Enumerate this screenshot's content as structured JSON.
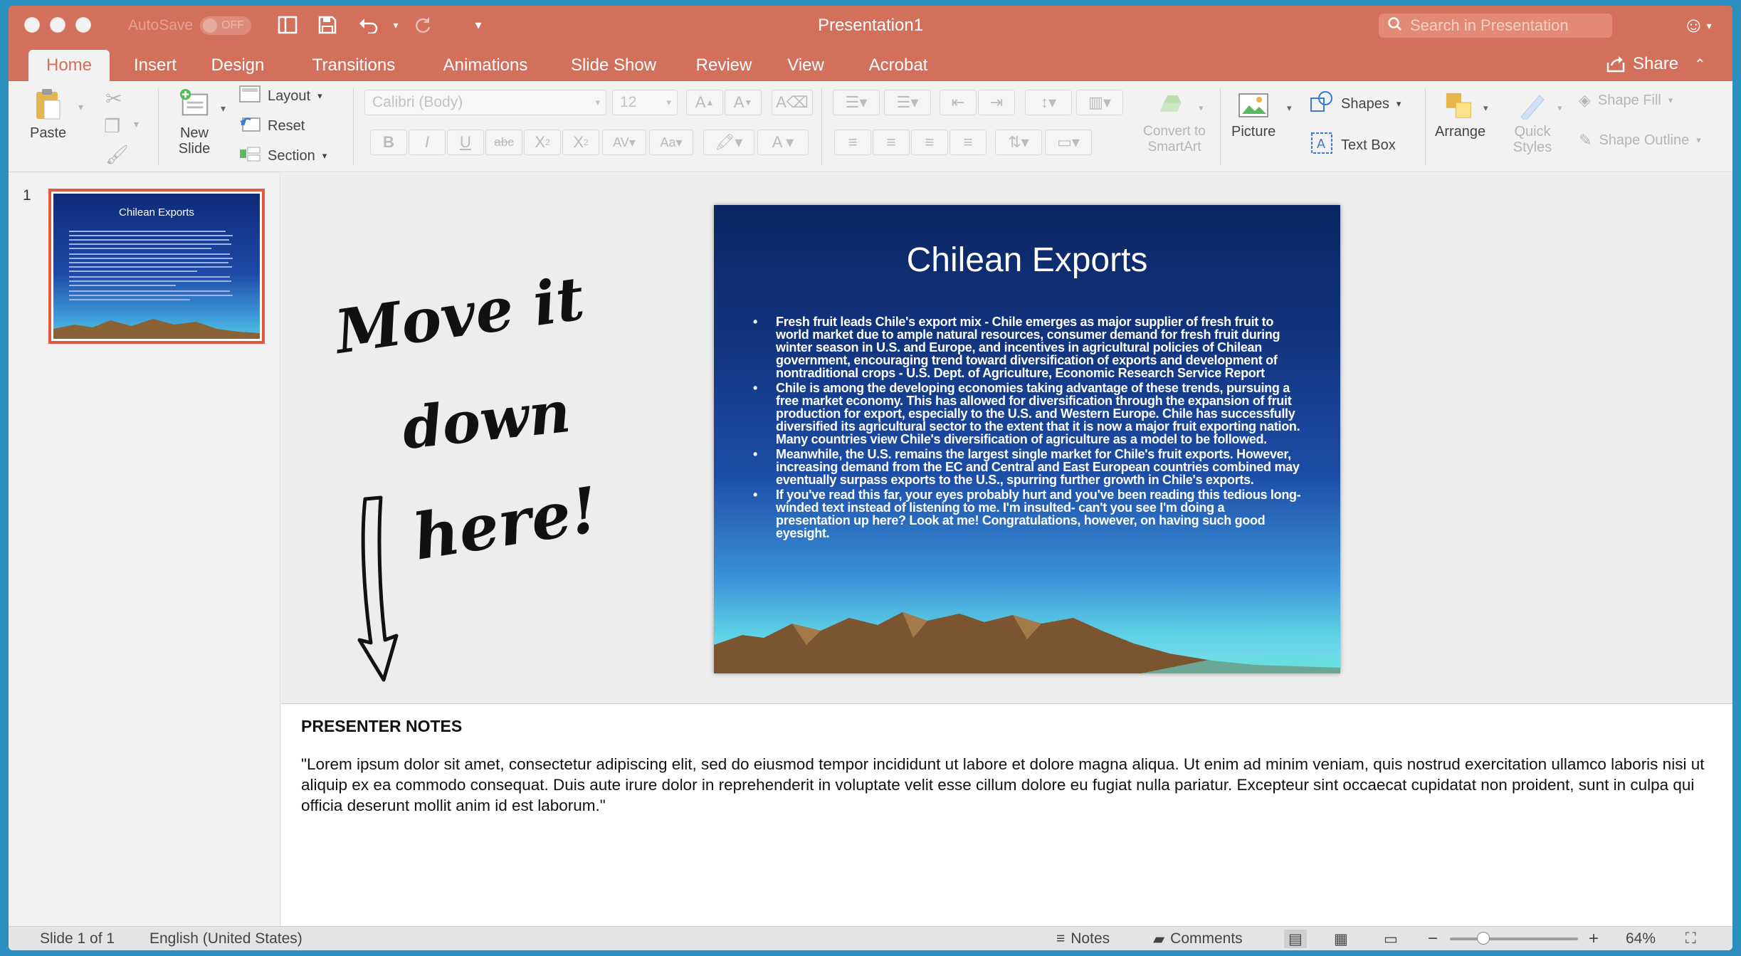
{
  "window": {
    "title": "Presentation1",
    "autosave_label": "AutoSave",
    "autosave_state": "OFF",
    "search_placeholder": "Search in Presentation"
  },
  "tabs": [
    {
      "label": "Home",
      "active": true
    },
    {
      "label": "Insert"
    },
    {
      "label": "Design"
    },
    {
      "label": "Transitions"
    },
    {
      "label": "Animations"
    },
    {
      "label": "Slide Show"
    },
    {
      "label": "Review"
    },
    {
      "label": "View"
    },
    {
      "label": "Acrobat"
    }
  ],
  "share_label": "Share",
  "ribbon": {
    "paste": "Paste",
    "new_slide": "New Slide",
    "layout": "Layout",
    "reset": "Reset",
    "section": "Section",
    "font_name": "Calibri (Body)",
    "font_size": "12",
    "convert_smartart": "Convert to SmartArt",
    "picture": "Picture",
    "shapes": "Shapes",
    "text_box": "Text Box",
    "arrange": "Arrange",
    "quick_styles": "Quick Styles",
    "shape_fill": "Shape Fill",
    "shape_outline": "Shape Outline"
  },
  "thumbnails": [
    {
      "number": "1",
      "title": "Chilean Exports"
    }
  ],
  "slide": {
    "title": "Chilean Exports",
    "bullets": [
      "Fresh fruit leads Chile's export mix - Chile emerges as major supplier of fresh fruit to world market due to ample natural resources, consumer demand for fresh fruit during winter season in U.S. and Europe, and incentives in agricultural policies of Chilean government, encouraging trend toward diversification of exports and development of nontraditional crops - U.S. Dept. of Agriculture, Economic Research Service Report",
      "Chile is among the developing economies taking advantage of these trends, pursuing a free market economy. This has allowed for diversification through the expansion of fruit production for export, especially to the U.S. and Western Europe. Chile has successfully diversified its agricultural sector to the extent that it is now a major fruit exporting nation. Many countries view Chile's diversification of agriculture as a model to be followed.",
      "Meanwhile, the U.S. remains the largest single market for Chile's fruit exports. However, increasing demand from the EC and Central and East European countries combined may eventually surpass exports to the U.S., spurring further growth in Chile's exports.",
      "If you've read this far, your eyes probably hurt and you've been reading this tedious long-winded text instead of listening to me. I'm insulted- can't you see I'm doing a presentation up here? Look at me! Congratulations, however, on having such good eyesight."
    ]
  },
  "annotation": {
    "line1": "Move it",
    "line2": "down",
    "line3": "here!"
  },
  "notes": {
    "heading": "PRESENTER NOTES",
    "body": "\"Lorem ipsum dolor sit amet, consectetur adipiscing elit, sed do eiusmod tempor incididunt ut labore et dolore magna aliqua. Ut enim ad minim veniam, quis nostrud exercitation ullamco laboris nisi ut aliquip ex ea commodo consequat. Duis aute irure dolor in reprehenderit in voluptate velit esse cillum dolore eu fugiat nulla pariatur. Excepteur sint occaecat cupidatat non proident, sunt in culpa qui officia deserunt mollit anim id est laborum.\""
  },
  "status": {
    "slide_info": "Slide 1 of 1",
    "language": "English (United States)",
    "notes_label": "Notes",
    "comments_label": "Comments",
    "zoom": "64%"
  },
  "colors": {
    "titlebar": "#d2705b",
    "thumb_selected": "#e05a3c"
  }
}
